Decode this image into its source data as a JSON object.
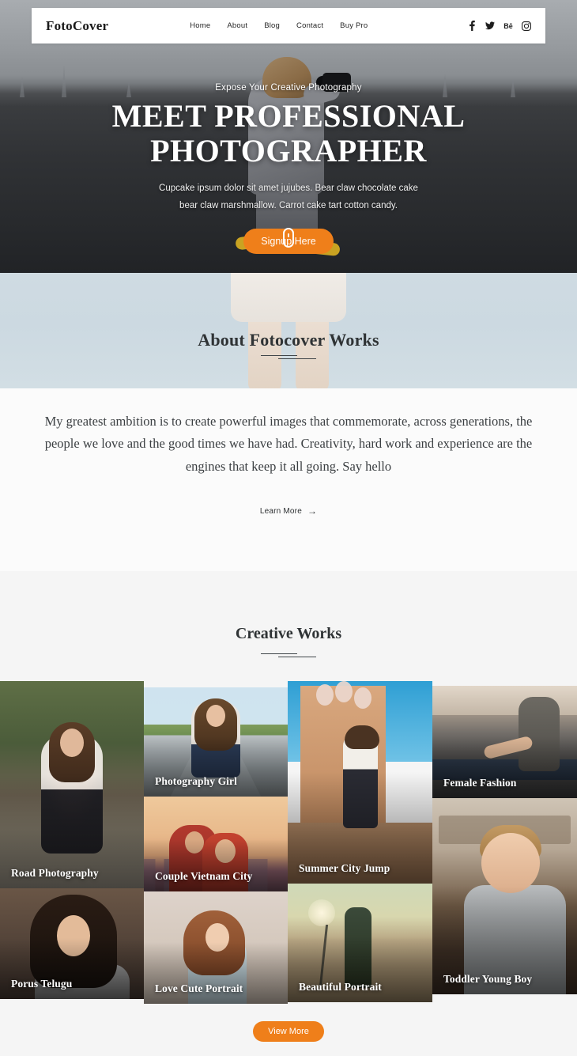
{
  "header": {
    "brand": "FotoCover",
    "nav": [
      {
        "label": "Home"
      },
      {
        "label": "About"
      },
      {
        "label": "Blog"
      },
      {
        "label": "Contact"
      },
      {
        "label": "Buy Pro"
      }
    ],
    "social": [
      {
        "name": "facebook-icon",
        "label": "f"
      },
      {
        "name": "twitter-icon",
        "label": "t"
      },
      {
        "name": "behance-icon",
        "label": "Bē"
      },
      {
        "name": "instagram-icon",
        "label": "ig"
      }
    ]
  },
  "hero": {
    "kicker": "Expose Your Creative Photography",
    "title": "MEET PROFESSIONAL PHOTOGRAPHER",
    "subtitle": "Cupcake ipsum dolor sit amet jujubes. Bear claw chocolate cake bear claw marshmallow. Carrot cake tart cotton candy.",
    "cta": "Signup Here",
    "scroll_indicator": "mouse-scroll-icon"
  },
  "about": {
    "heading": "About Fotocover Works",
    "paragraph": "My greatest ambition is to create powerful images that commemorate, across generations, the people we love and the good times we have had. Creativity, hard work and experience are the engines that keep it all going. Say hello",
    "link": "Learn More",
    "link_arrow": "→"
  },
  "works": {
    "heading": "Creative Works",
    "view_more": "View More",
    "items": [
      {
        "caption": "Road Photography",
        "style": "ph-road",
        "tile": "t-road",
        "col": 1
      },
      {
        "caption": "Porus Telugu",
        "style": "ph-porus",
        "tile": "t-porus",
        "col": 1
      },
      {
        "caption": "Photography Girl",
        "style": "ph-girl",
        "tile": "t-girl",
        "col": 2
      },
      {
        "caption": "Couple Vietnam City",
        "style": "ph-couple",
        "tile": "t-couple",
        "col": 2
      },
      {
        "caption": "Love Cute Portrait",
        "style": "ph-love",
        "tile": "t-love",
        "col": 2
      },
      {
        "caption": "Summer City Jump",
        "style": "ph-summer",
        "tile": "t-summer",
        "col": 3
      },
      {
        "caption": "Beautiful Portrait",
        "style": "ph-beautiful",
        "tile": "t-beautiful",
        "col": 3
      },
      {
        "caption": "Female Fashion",
        "style": "ph-fashion",
        "tile": "t-fashion",
        "col": 4
      },
      {
        "caption": "Toddler Young Boy",
        "style": "ph-toddler",
        "tile": "t-toddler",
        "col": 4
      }
    ]
  },
  "colors": {
    "accent": "#ef7f1a",
    "nav_bg": "#ffffff",
    "about_banner_bg": "#ccd9e1",
    "works_bg": "#f5f5f5",
    "heading": "#2f3335"
  }
}
